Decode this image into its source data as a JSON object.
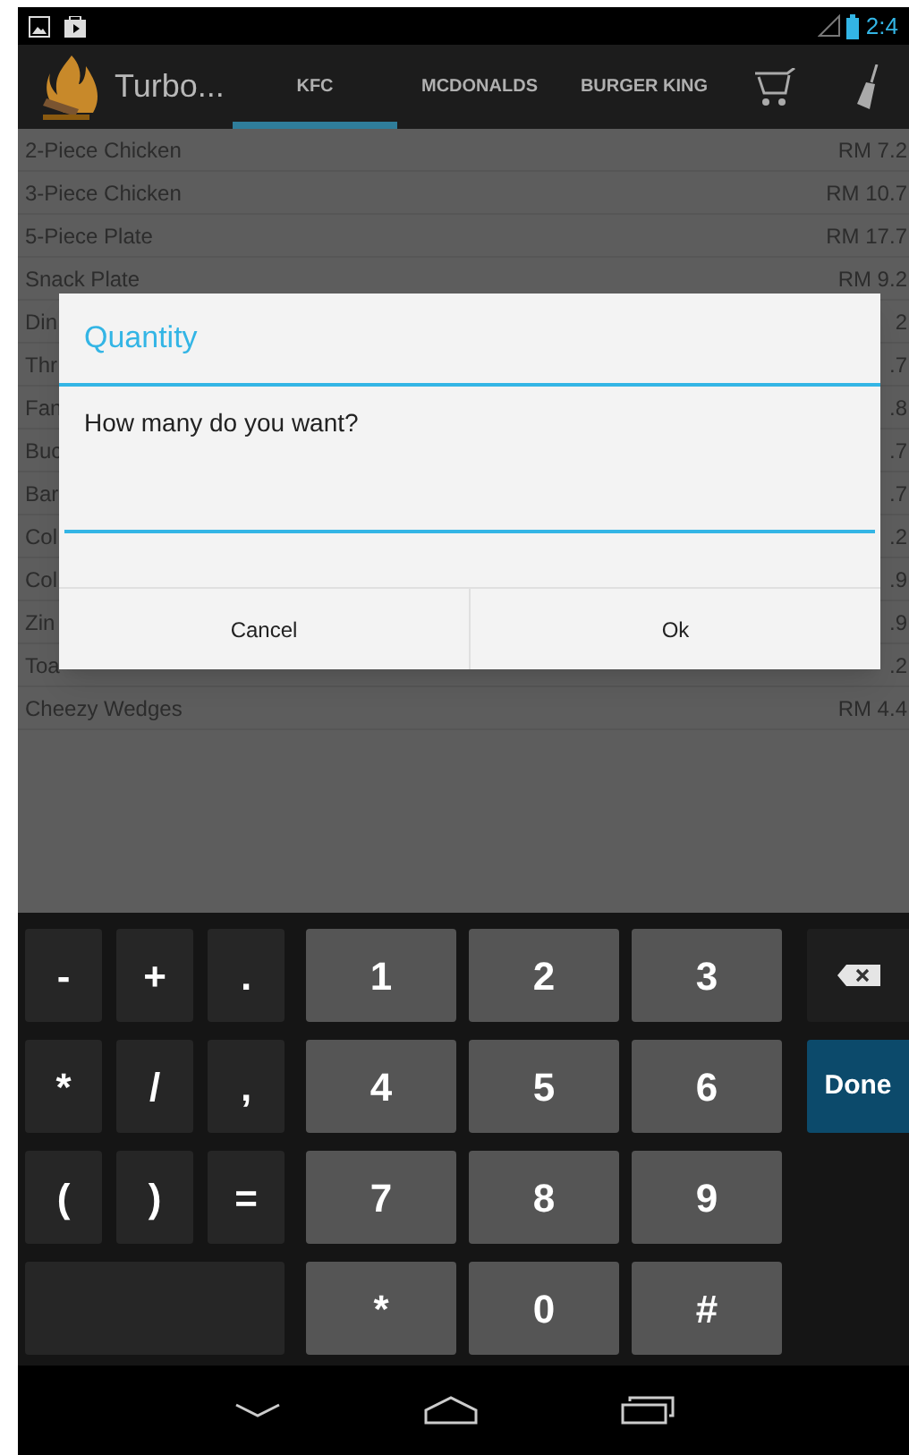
{
  "status_bar": {
    "time": "2:4"
  },
  "action_bar": {
    "title": "Turbo..."
  },
  "tabs": [
    {
      "label": "KFC",
      "selected": true
    },
    {
      "label": "MCDONALDS",
      "selected": false
    },
    {
      "label": "BURGER KING",
      "selected": false
    }
  ],
  "menu_items": [
    {
      "name": "2-Piece Chicken",
      "price": "RM 7.2"
    },
    {
      "name": "3-Piece Chicken",
      "price": "RM 10.7"
    },
    {
      "name": "5-Piece Plate",
      "price": "RM 17.7"
    },
    {
      "name": "Snack Plate",
      "price": "RM 9.2"
    },
    {
      "name": "Din",
      "price": "2"
    },
    {
      "name": "Thr",
      "price": ".7"
    },
    {
      "name": "Fan",
      "price": ".8"
    },
    {
      "name": "Buc",
      "price": ".7"
    },
    {
      "name": "Bar",
      "price": ".7"
    },
    {
      "name": "Col",
      "price": ".2"
    },
    {
      "name": "Col",
      "price": ".9"
    },
    {
      "name": "Zin",
      "price": ".9"
    },
    {
      "name": "Toa",
      "price": ".2"
    },
    {
      "name": "Cheezy Wedges",
      "price": "RM 4.4"
    }
  ],
  "dialog": {
    "title": "Quantity",
    "message": "How many do you want?",
    "buttons": [
      "Cancel",
      "Ok"
    ]
  },
  "keyboard": {
    "symbol_keys": [
      "-",
      "+",
      ".",
      "*",
      "/",
      ",",
      "(",
      ")",
      "="
    ],
    "number_keys": [
      "1",
      "2",
      "3",
      "4",
      "5",
      "6",
      "7",
      "8",
      "9",
      "*",
      "0",
      "#"
    ],
    "side_keys": [
      {
        "kind": "backspace"
      },
      {
        "label": "Done",
        "kind": "done"
      }
    ]
  }
}
